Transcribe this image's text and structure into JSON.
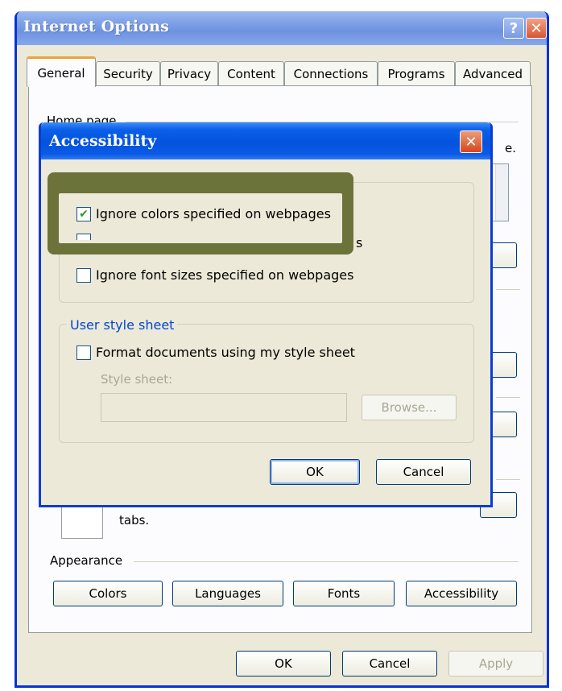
{
  "outer": {
    "title": "Internet Options",
    "help_glyph": "?",
    "close_glyph": "✕",
    "tabs": [
      {
        "label": "General"
      },
      {
        "label": "Security"
      },
      {
        "label": "Privacy"
      },
      {
        "label": "Content"
      },
      {
        "label": "Connections"
      },
      {
        "label": "Programs"
      },
      {
        "label": "Advanced"
      }
    ],
    "active_tab": "General",
    "home_page_label": "Home page",
    "home_page_text_fragment": "e.",
    "tabs_fragment": "tabs.",
    "appearance_label": "Appearance",
    "appearance_buttons": {
      "colors": "Colors",
      "languages": "Languages",
      "fonts": "Fonts",
      "accessibility": "Accessibility"
    },
    "footer": {
      "ok": "OK",
      "cancel": "Cancel",
      "apply": "Apply"
    }
  },
  "accessibility": {
    "title": "Accessibility",
    "close_glyph": "✕",
    "formatting": {
      "ignore_colors": {
        "label": "Ignore colors specified on webpages",
        "checked": true
      },
      "ignore_font_styles_fragment": "s",
      "ignore_font_sizes": {
        "label": "Ignore font sizes specified on webpages",
        "checked": false
      }
    },
    "user_style_sheet": {
      "legend": "User style sheet",
      "format_docs": {
        "label": "Format documents using my style sheet",
        "checked": false
      },
      "style_sheet_label": "Style sheet:",
      "style_sheet_value": "",
      "browse": "Browse..."
    },
    "ok": "OK",
    "cancel": "Cancel"
  },
  "colors": {
    "highlight_overlay": "#6b733a",
    "titlebar_active": "#0453dd",
    "titlebar_inactive": "#7fa0e6",
    "window_face": "#ece9d8",
    "legend_blue": "#0046d5"
  }
}
